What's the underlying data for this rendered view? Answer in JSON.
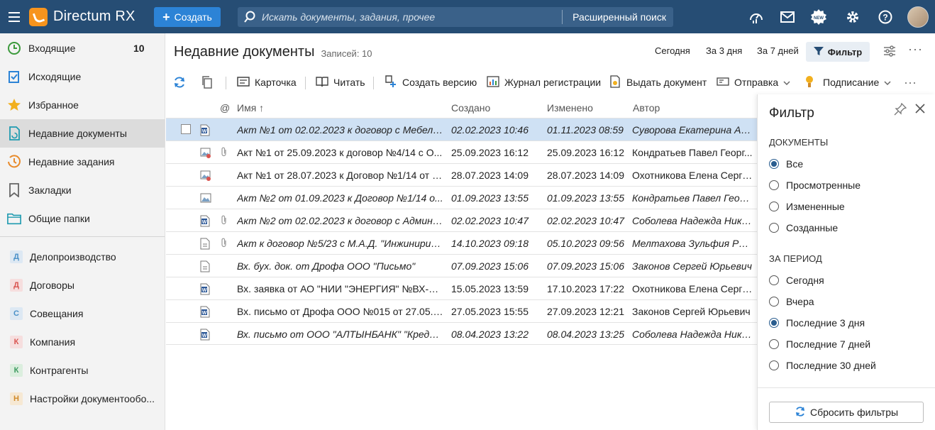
{
  "app": {
    "title": "Directum RX",
    "create_label": "Создать",
    "search_placeholder": "Искать документы, задания, прочее",
    "adv_search_label": "Расширенный поиск",
    "new_badge": "NEW"
  },
  "sidebar": {
    "items": [
      {
        "label": "Входящие",
        "count": "10",
        "icon": "clock-icon"
      },
      {
        "label": "Исходящие",
        "icon": "outgoing-check-icon"
      },
      {
        "label": "Избранное",
        "icon": "star-icon"
      },
      {
        "label": "Недавние документы",
        "icon": "recent-docs-icon"
      },
      {
        "label": "Недавние задания",
        "icon": "recent-tasks-icon"
      },
      {
        "label": "Закладки",
        "icon": "bookmark-icon"
      },
      {
        "label": "Общие папки",
        "icon": "folder-icon"
      }
    ],
    "modules": [
      {
        "letter": "Д",
        "label": "Делопроизводство",
        "color": "#4a90c8",
        "bg": "#dde8f3"
      },
      {
        "letter": "Д",
        "label": "Договоры",
        "color": "#d9534f",
        "bg": "#f6dede"
      },
      {
        "letter": "С",
        "label": "Совещания",
        "color": "#4a90c8",
        "bg": "#dde8f3"
      },
      {
        "letter": "К",
        "label": "Компания",
        "color": "#d9534f",
        "bg": "#f6dede"
      },
      {
        "letter": "К",
        "label": "Контрагенты",
        "color": "#3c9a5f",
        "bg": "#dbeede"
      },
      {
        "letter": "Н",
        "label": "Настройки документообо...",
        "color": "#d08a2a",
        "bg": "#f6e8d3"
      }
    ]
  },
  "header": {
    "title": "Недавние документы",
    "records": "Записей: 10",
    "period_today": "Сегодня",
    "period_3": "За 3 дня",
    "period_7": "За 7 дней",
    "filter_label": "Фильтр"
  },
  "toolbar": {
    "card": "Карточка",
    "read": "Читать",
    "create_version": "Создать версию",
    "journal": "Журнал регистрации",
    "issue": "Выдать документ",
    "send": "Отправка",
    "sign": "Подписание"
  },
  "table": {
    "headers": {
      "at": "@",
      "name": "Имя",
      "created": "Создано",
      "modified": "Изменено",
      "author": "Автор"
    },
    "rows": [
      {
        "name": "Акт №1 от 02.02.2023 к договор с Мебельс...",
        "created": "02.02.2023 10:46",
        "modified": "01.11.2023 08:59",
        "author": "Суворова Екатерина Ан...",
        "italic": true,
        "icon": "word",
        "clip": false,
        "selected": true
      },
      {
        "name": "Акт №1 от 25.09.2023 к договор №4/14 с О...",
        "created": "25.09.2023 16:12",
        "modified": "25.09.2023 16:12",
        "author": "Кондратьев Павел Георг...",
        "italic": false,
        "icon": "image-stamp",
        "clip": true
      },
      {
        "name": "Акт №1 от 28.07.2023 к Договор №1/14 от 2...",
        "created": "28.07.2023 14:09",
        "modified": "28.07.2023 14:09",
        "author": "Охотникова Елена Серге...",
        "italic": false,
        "icon": "image-stamp",
        "clip": false
      },
      {
        "name": "Акт №2 от 01.09.2023 к Договор №1/14 о...",
        "created": "01.09.2023 13:55",
        "modified": "01.09.2023 13:55",
        "author": "Кондратьев Павел Георг...",
        "italic": true,
        "icon": "image",
        "clip": false
      },
      {
        "name": "Акт №2 от 02.02.2023 к договор с Админи...",
        "created": "02.02.2023 10:47",
        "modified": "02.02.2023 10:47",
        "author": "Соболева Надежда Нико...",
        "italic": true,
        "icon": "word",
        "clip": true
      },
      {
        "name": "Акт к договор №5/23 с М.А.Д. \"Инжинирин...",
        "created": "14.10.2023 09:18",
        "modified": "05.10.2023 09:56",
        "author": "Мелтахова Зульфия Раш...",
        "italic": true,
        "icon": "doc",
        "clip": true
      },
      {
        "name": "Вх. бух. док. от Дрофа ООО \"Письмо\"",
        "created": "07.09.2023 15:06",
        "modified": "07.09.2023 15:06",
        "author": "Законов Сергей Юрьевич",
        "italic": true,
        "icon": "doc",
        "clip": false
      },
      {
        "name": "Вх. заявка от АО \"НИИ \"ЭНЕРГИЯ\" №ВХ-П-0...",
        "created": "15.05.2023 13:59",
        "modified": "17.10.2023 17:22",
        "author": "Охотникова Елена Серге...",
        "italic": false,
        "icon": "word",
        "clip": false
      },
      {
        "name": "Вх. письмо от Дрофа ООО №015 от 27.05.2...",
        "created": "27.05.2023 15:55",
        "modified": "27.09.2023 12:21",
        "author": "Законов Сергей Юрьевич",
        "italic": false,
        "icon": "word",
        "clip": false
      },
      {
        "name": "Вх. письмо от ООО \"АЛТЫНБАНК\" \"Кредит...",
        "created": "08.04.2023 13:22",
        "modified": "08.04.2023 13:25",
        "author": "Соболева Надежда Нико...",
        "italic": true,
        "icon": "word",
        "clip": false
      }
    ]
  },
  "filter": {
    "title": "Фильтр",
    "docs_section": "ДОКУМЕНТЫ",
    "docs_options": [
      {
        "label": "Все",
        "checked": true
      },
      {
        "label": "Просмотренные",
        "checked": false
      },
      {
        "label": "Измененные",
        "checked": false
      },
      {
        "label": "Созданные",
        "checked": false
      }
    ],
    "period_section": "ЗА ПЕРИОД",
    "period_options": [
      {
        "label": "Сегодня",
        "checked": false
      },
      {
        "label": "Вчера",
        "checked": false
      },
      {
        "label": "Последние 3 дня",
        "checked": true
      },
      {
        "label": "Последние 7 дней",
        "checked": false
      },
      {
        "label": "Последние 30 дней",
        "checked": false
      }
    ],
    "reset_label": "Сбросить фильтры"
  },
  "colors": {
    "topbar": "#264d74",
    "accent": "#2c83d6",
    "selected_row": "#cfe1f4",
    "logo": "#f7941d"
  }
}
